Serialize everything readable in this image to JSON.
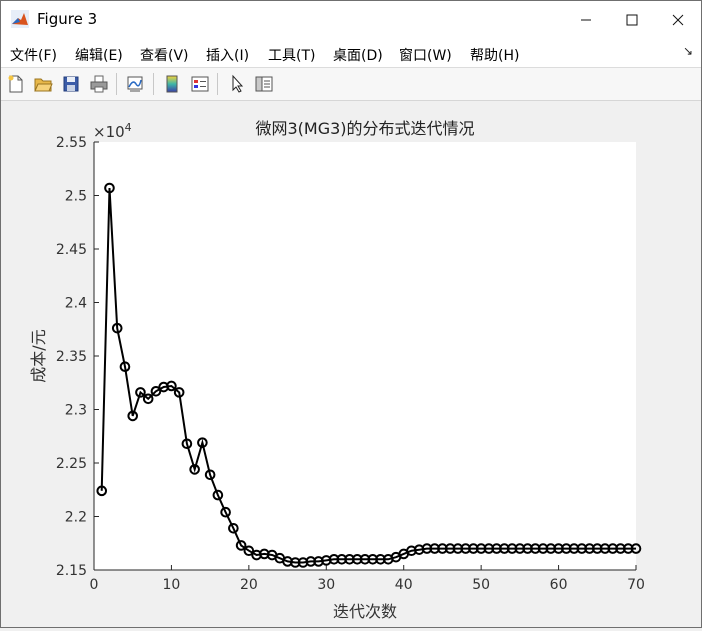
{
  "window": {
    "title": "Figure 3"
  },
  "menu": [
    {
      "label": "文件(F)"
    },
    {
      "label": "编辑(E)"
    },
    {
      "label": "查看(V)"
    },
    {
      "label": "插入(I)"
    },
    {
      "label": "工具(T)"
    },
    {
      "label": "桌面(D)"
    },
    {
      "label": "窗口(W)"
    },
    {
      "label": "帮助(H)"
    }
  ],
  "toolbar": [
    "new-figure-icon",
    "open-file-icon",
    "save-icon",
    "print-icon",
    "link-plot-icon",
    "insert-colorbar-icon",
    "insert-legend-icon",
    "edit-plot-arrow-icon",
    "property-inspector-icon"
  ],
  "chart_data": {
    "type": "line",
    "title": "微网3(MG3)的分布式迭代情况",
    "xlabel": "迭代次数",
    "ylabel": "成本/元",
    "exponent_label": "×10",
    "exponent_power": "4",
    "xlim": [
      0,
      70
    ],
    "ylim": [
      2.15,
      2.55
    ],
    "xticks": [
      "0",
      "10",
      "20",
      "30",
      "40",
      "50",
      "60",
      "70"
    ],
    "yticks": [
      "2.15",
      "2.2",
      "2.25",
      "2.3",
      "2.35",
      "2.4",
      "2.45",
      "2.5",
      "2.55"
    ],
    "grid": false,
    "marker": "circle",
    "color": "#000000",
    "series": [
      {
        "x": [
          1,
          2,
          3,
          4,
          5,
          6,
          7,
          8,
          9,
          10,
          11,
          12,
          13,
          14,
          15,
          16,
          17,
          18,
          19,
          20,
          21,
          22,
          23,
          24,
          25,
          26,
          27,
          28,
          29,
          30,
          31,
          32,
          33,
          34,
          35,
          36,
          37,
          38,
          39,
          40,
          41,
          42,
          43,
          44,
          45,
          46,
          47,
          48,
          49,
          50,
          51,
          52,
          53,
          54,
          55,
          56,
          57,
          58,
          59,
          60,
          61,
          62,
          63,
          64,
          65,
          66,
          67,
          68,
          69,
          70
        ],
        "y": [
          2.224,
          2.507,
          2.376,
          2.34,
          2.294,
          2.316,
          2.31,
          2.317,
          2.321,
          2.322,
          2.316,
          2.268,
          2.244,
          2.269,
          2.239,
          2.22,
          2.204,
          2.189,
          2.173,
          2.168,
          2.164,
          2.165,
          2.164,
          2.161,
          2.158,
          2.157,
          2.157,
          2.158,
          2.158,
          2.159,
          2.16,
          2.16,
          2.16,
          2.16,
          2.16,
          2.16,
          2.16,
          2.16,
          2.162,
          2.165,
          2.168,
          2.169,
          2.17,
          2.17,
          2.17,
          2.17,
          2.17,
          2.17,
          2.17,
          2.17,
          2.17,
          2.17,
          2.17,
          2.17,
          2.17,
          2.17,
          2.17,
          2.17,
          2.17,
          2.17,
          2.17,
          2.17,
          2.17,
          2.17,
          2.17,
          2.17,
          2.17,
          2.17,
          2.17,
          2.17
        ]
      }
    ]
  }
}
